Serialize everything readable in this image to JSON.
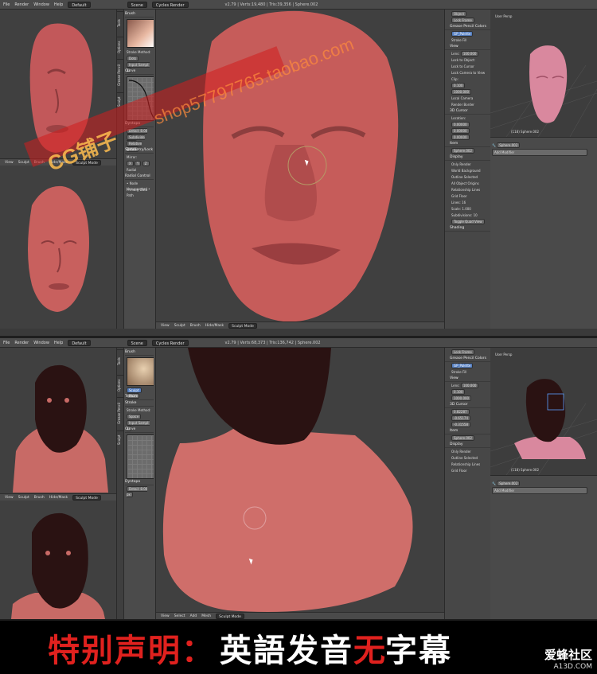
{
  "top": {
    "menu": {
      "items": [
        "File",
        "Render",
        "Window",
        "Help"
      ],
      "layout": "Default",
      "scene": "Scene",
      "engine": "Cycles Render",
      "info": "v2.79 | Verts:19,480 | Tris:39,356 | Sphere.002"
    },
    "viewport_header": {
      "items": [
        "View",
        "Sculpt",
        "Brush",
        "Hide/Mask"
      ],
      "mode": "Sculpt Mode"
    },
    "left_header": {
      "items": [
        "View",
        "Sculpt",
        "Brush",
        "Hide/Mask"
      ],
      "mode": "Sculpt Mode"
    },
    "tool_tabs": [
      "Tools",
      "Options",
      "Grease Pencil",
      "Sculpt"
    ],
    "tool_panel": {
      "brush": "Brush",
      "stroke_method_label": "Stroke Method:",
      "stroke_method": "Dots",
      "input_samples": "Input Sampl: 1",
      "curve": "Curve",
      "dyntopo": "Dyntopo",
      "detail": "Detail: 8.00 px",
      "subdivide": "Subdivide Colla",
      "relative": "Relative Detail",
      "symmetry": "Symmetry/Lock",
      "mirror": "Mirror:",
      "axes": [
        "X",
        "Y",
        "Z"
      ],
      "radial": "Radial",
      "radial_control": "Radial Control",
      "note": "• Node Unsupported •",
      "primary_data": "Primary Data Path",
      "tools_note": "Brush Settings"
    },
    "props": {
      "object_btn": "Object",
      "lock_frame": "Lock Frame",
      "grease": "Grease Pencil Colors",
      "gp_palette": "GP_Palette",
      "stroke": "Stroke",
      "fill": "Fill",
      "view": "View",
      "lens": "Lens:",
      "lens_val": "100.000",
      "lock_object": "Lock to Object:",
      "lock_cursor": "Lock to Cursor",
      "lock_camera": "Lock Camera to View",
      "clip": "Clip:",
      "clip_start": "0.100",
      "clip_end": "1000.000",
      "local_camera": "Local Camera",
      "render_border": "Render Border",
      "cursor3d": "3D Cursor",
      "location": "Location:",
      "loc": [
        "0.00000",
        "0.00000",
        "0.00000"
      ],
      "item": "Item",
      "item_name": "Sphere.002",
      "display": "Display",
      "only_render": "Only Render",
      "world_bg": "World Background",
      "outline": "Outline Selected",
      "all_origins": "All Object Origins",
      "rel_lines": "Relationship Lines",
      "grid_floor": "Grid Floor",
      "lines": "Lines:",
      "lines_val": "16",
      "scale": "Scale:",
      "scale_val": "1.000",
      "subdiv": "Subdivisions:",
      "subdiv_val": "10",
      "toggle_quad": "Toggle Quad View",
      "shading": "Shading"
    },
    "rp": {
      "title": "User Persp",
      "object": "(118) Sphere.002",
      "modifier_btn": "Add Modifier",
      "obj_name": "Sphere.002"
    }
  },
  "bottom": {
    "menu": {
      "items": [
        "File",
        "Render",
        "Window",
        "Help"
      ],
      "layout": "Default",
      "scene": "Scene",
      "engine": "Cycles Render",
      "info": "v2.79 | Verts:68,373 | Tris:136,742 | Sphere.002"
    },
    "viewport_header": {
      "items": [
        "View",
        "Select",
        "Add",
        "Mesh"
      ],
      "mode": "Sculpt Mode"
    },
    "left_header": {
      "items": [
        "View",
        "Sculpt",
        "Brush",
        "Hide/Mask"
      ],
      "mode": "Sculpt Mode"
    },
    "tool_panel": {
      "brush": "Brush",
      "texture": "Texture",
      "stroke": "Stroke",
      "stroke_method_label": "Stroke Method:",
      "stroke_method": "Space",
      "input_samples": "Input Sampl: 1",
      "curve": "Curve",
      "dyntopo": "Dyntopo",
      "detail": "Detail: 8.00 px",
      "sculpt": "Sculpt",
      "paint": "Paint"
    },
    "props": {
      "lock_frame": "Lock Frame",
      "grease": "Grease Pencil Colors",
      "gp_palette": "GP_Palette",
      "stroke": "Stroke",
      "fill": "Fill",
      "view": "View",
      "lens": "Lens:",
      "lens_val": "100.000",
      "clip_start": "0.100",
      "clip_end": "1000.000",
      "cursor3d": "3D Cursor",
      "loc": [
        "0.82287",
        "-0.65174",
        "-0.31558"
      ],
      "item": "Item",
      "item_name": "Sphere.002",
      "display": "Display",
      "only_render": "Only Render",
      "outline": "Outline Selected",
      "rel_lines": "Relationship Lines",
      "grid_floor": "Grid Floor"
    },
    "rp": {
      "title": "User Persp",
      "object": "(118) Sphere.002",
      "modifier_btn": "Add Modifier",
      "obj_name": "Sphere.002"
    }
  },
  "watermark": {
    "site": "shop57797765.taobao.com",
    "brand": "CG铺子"
  },
  "banner": {
    "part1": "特别声明：",
    "part2": "英語发音",
    "part3": "无",
    "part4": "字幕",
    "logo": "爱蜂社区",
    "logo_sub": "A13D.COM"
  }
}
